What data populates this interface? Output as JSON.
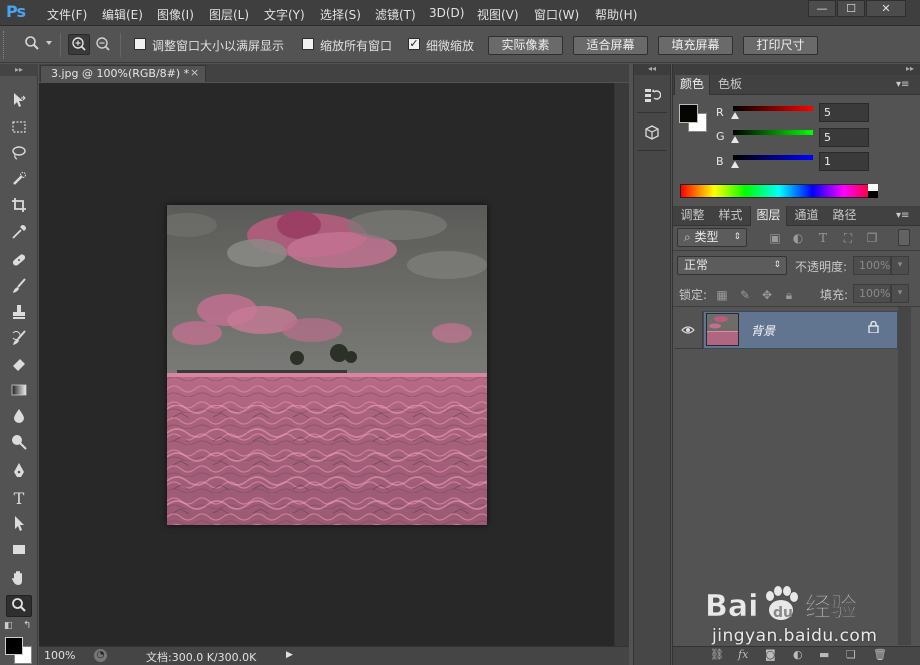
{
  "app": {
    "logo": "Ps"
  },
  "menu": [
    "文件(F)",
    "编辑(E)",
    "图像(I)",
    "图层(L)",
    "文字(Y)",
    "选择(S)",
    "滤镜(T)",
    "3D(D)",
    "视图(V)",
    "窗口(W)",
    "帮助(H)"
  ],
  "window_controls": {
    "minimize": "—",
    "maximize": "☐",
    "close": "✕"
  },
  "options": {
    "resize_windows_label": "调整窗口大小以满屏显示",
    "resize_windows_checked": false,
    "zoom_all_label": "缩放所有窗口",
    "zoom_all_checked": false,
    "scrubby_label": "细微缩放",
    "scrubby_checked": true,
    "actual_pixels": "实际像素",
    "fit_screen": "适合屏幕",
    "fill_screen": "填充屏幕",
    "print_size": "打印尺寸"
  },
  "document": {
    "tab_title": "3.jpg @ 100%(RGB/8#) *",
    "tab_close": "×"
  },
  "status": {
    "zoom": "100%",
    "doc_size": "文档:300.0 K/300.0K"
  },
  "color_panel": {
    "tabs": [
      "颜色",
      "色板"
    ],
    "r_label": "R",
    "g_label": "G",
    "b_label": "B",
    "r_value": "5",
    "g_value": "5",
    "b_value": "1",
    "fg_color": "#050501",
    "bg_color": "#ffffff"
  },
  "layers_panel": {
    "tabs": [
      "调整",
      "样式",
      "图层",
      "通道",
      "路径"
    ],
    "filter_kind": "类型",
    "blend_mode": "正常",
    "opacity_label": "不透明度:",
    "opacity_value": "100%",
    "lock_label": "锁定:",
    "fill_label": "填充:",
    "fill_value": "100%",
    "layers": [
      {
        "name": "背景",
        "visible": true,
        "locked": true
      }
    ]
  },
  "watermark": {
    "brand": "Baidu经验",
    "url": "jingyan.baidu.com"
  },
  "colors": {
    "accent_pink": "#d46a8c",
    "layer_selected": "#627590"
  }
}
